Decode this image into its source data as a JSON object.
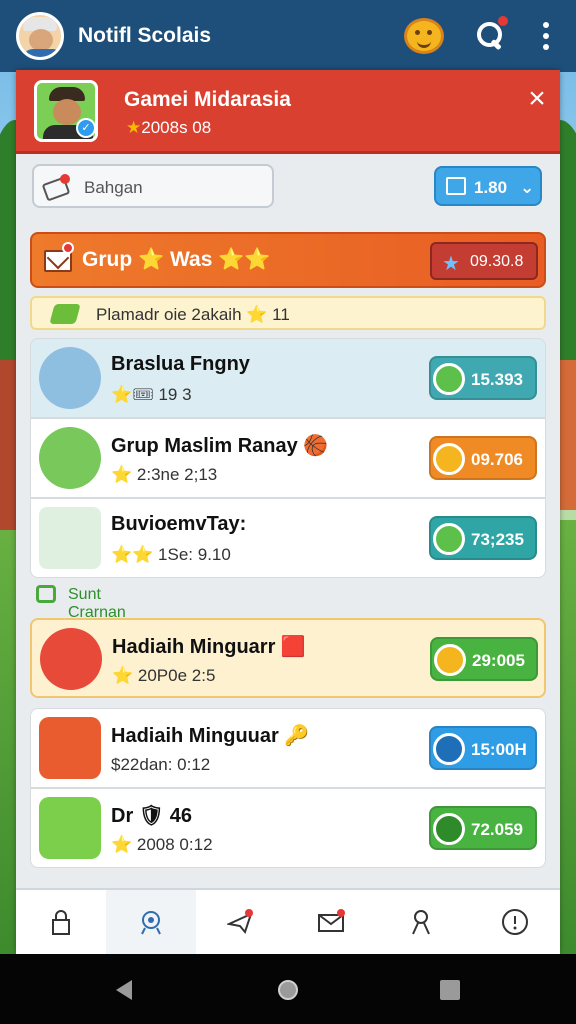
{
  "app": {
    "title": "Notifl Scolais"
  },
  "topbar": {
    "icons": [
      "avatar",
      "coin-face-icon",
      "search-icon",
      "more-vertical-icon"
    ]
  },
  "header_card": {
    "title": "Gamei Midarasia",
    "subtitle": "2008s 08",
    "close_icon": "close-icon"
  },
  "search": {
    "placeholder": "Bahgan"
  },
  "filter": {
    "label": "1.80",
    "chevron": "chevron-down-icon"
  },
  "group": {
    "title": "Grup ⭐ Was ⭐⭐",
    "value": "09.30.8"
  },
  "subheader": {
    "text": "Plamadr oie 2akaih ⭐ 11"
  },
  "rows": [
    {
      "name": "Braslua Fngny",
      "meta": "⭐🎟 19 3",
      "value": "15.393",
      "pill_color": "#40a8b0",
      "bg": "#dcecf3",
      "avatar": "person-icon"
    },
    {
      "name": "Grup Maslim Ranay 🏀",
      "meta": "⭐ 2:3ne 2;13",
      "value": "09.706",
      "pill_color": "#f08a24",
      "bg": "#ffffff",
      "avatar": "cowboy-avatar"
    },
    {
      "name": "BuvioemvTay:",
      "meta": "⭐⭐ 1Se: 9.10",
      "value": "73;235",
      "pill_color": "#30a5a5",
      "bg": "#ffffff",
      "avatar": "gift-box-icon"
    },
    {
      "name": "Hadiaih Minguarr 🟥",
      "meta": "⭐ 20P0e 2:5",
      "value": "29:005",
      "pill_color": "#48b341",
      "bg": "#fdf1cf",
      "avatar": "cowboy-avatar"
    },
    {
      "name": "Hadiaih Minguuar 🔑",
      "meta": "$22dan: 0:12",
      "value": "15:00H",
      "pill_color": "#2f9ce6",
      "bg": "#ffffff",
      "avatar": "trophy-icon"
    },
    {
      "name": "Dr 🛡 46",
      "meta": "⭐ 2008 0:12",
      "value": "72.059",
      "pill_color": "#48b341",
      "bg": "#ffffff",
      "avatar": "target-icon"
    }
  ],
  "section": {
    "label": "Sunt Crarnan S.ars"
  },
  "bottom_nav": [
    "lock-icon",
    "location-badge-icon",
    "message-icon",
    "mail-icon",
    "pin-person-icon",
    "info-circle-icon"
  ]
}
